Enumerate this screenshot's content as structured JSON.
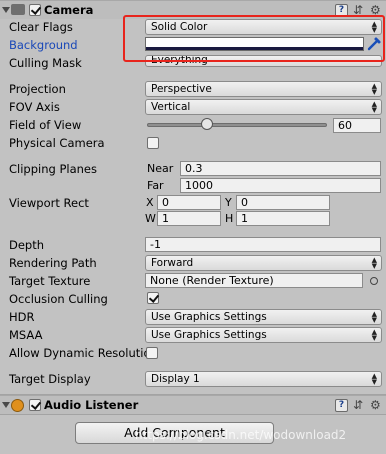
{
  "camera": {
    "title": "Camera",
    "enabled": true,
    "clear_flags": {
      "label": "Clear Flags",
      "value": "Solid Color"
    },
    "background": {
      "label": "Background",
      "color": "#1a1a40"
    },
    "culling_mask": {
      "label": "Culling Mask",
      "value": "Everything"
    },
    "projection": {
      "label": "Projection",
      "value": "Perspective"
    },
    "fov_axis": {
      "label": "FOV Axis",
      "value": "Vertical"
    },
    "field_of_view": {
      "label": "Field of View",
      "value": "60",
      "slider_fraction": 0.33
    },
    "physical_camera": {
      "label": "Physical Camera",
      "checked": false
    },
    "clipping_planes": {
      "label": "Clipping Planes",
      "near_label": "Near",
      "near": "0.3",
      "far_label": "Far",
      "far": "1000"
    },
    "viewport_rect": {
      "label": "Viewport Rect",
      "x_label": "X",
      "x": "0",
      "y_label": "Y",
      "y": "0",
      "w_label": "W",
      "w": "1",
      "h_label": "H",
      "h": "1"
    },
    "depth": {
      "label": "Depth",
      "value": "-1"
    },
    "rendering_path": {
      "label": "Rendering Path",
      "value": "Forward"
    },
    "target_texture": {
      "label": "Target Texture",
      "value": "None (Render Texture)"
    },
    "occlusion_culling": {
      "label": "Occlusion Culling",
      "checked": true
    },
    "hdr": {
      "label": "HDR",
      "value": "Use Graphics Settings"
    },
    "msaa": {
      "label": "MSAA",
      "value": "Use Graphics Settings"
    },
    "allow_dynamic_resolution": {
      "label": "Allow Dynamic Resolutio",
      "checked": false
    },
    "target_display": {
      "label": "Target Display",
      "value": "Display 1"
    }
  },
  "audio_listener": {
    "title": "Audio Listener",
    "enabled": true
  },
  "add_component": {
    "label": "Add Component"
  },
  "watermark": "https://blog.csdn.net/wodownload2",
  "colors": {
    "highlight": "#e8241c",
    "label_selected": "#1a48b8"
  }
}
